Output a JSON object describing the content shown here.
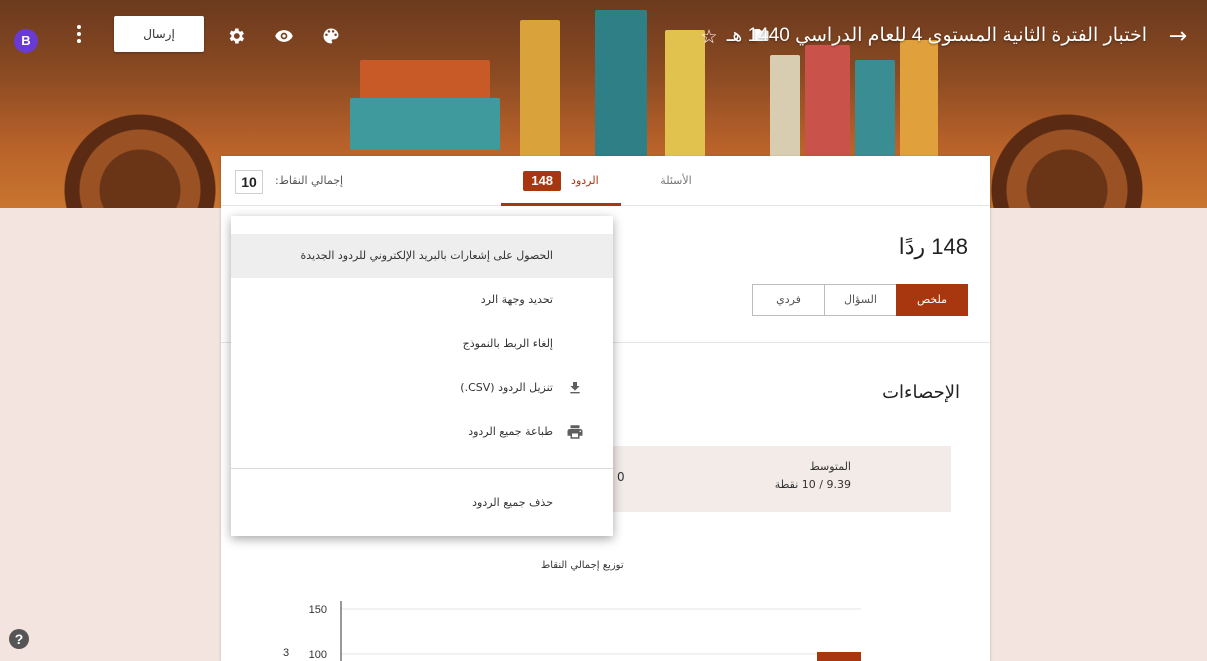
{
  "header": {
    "title": "اختبار الفترة الثانية المستوى 4 للعام الدراسي 1440 هـ",
    "avatar_letter": "B",
    "send_label": "إرسال",
    "icons": [
      "back-arrow-icon",
      "folder-icon",
      "star-icon",
      "palette-icon",
      "eye-icon",
      "gear-icon",
      "more-vert-icon"
    ]
  },
  "tabs": {
    "questions_label": "الأسئلة",
    "responses_label": "الردود",
    "responses_count": "148",
    "total_points_label": "إجمالي النقاط:",
    "total_points_value": "10"
  },
  "summary": {
    "response_count_text": "148 ردًا",
    "segments": [
      "ملخص",
      "السؤال",
      "فردي"
    ],
    "stats_title": "الإحصاءات",
    "average_label": "المتوسط",
    "average_value": "9.39 / 10 نقطة",
    "other_stat_value": "0",
    "chart_title": "توزيع إجمالي النقاط"
  },
  "menu": {
    "items": [
      {
        "label": "الحصول على إشعارات بالبريد الإلكتروني للردود الجديدة",
        "icon": ""
      },
      {
        "label": "تحديد وجهة الرد",
        "icon": ""
      },
      {
        "label": "إلغاء الربط بالنموذج",
        "icon": ""
      },
      {
        "label": "تنزيل الردود (CSV.)",
        "icon": "download-icon"
      },
      {
        "label": "طباعة جميع الردود",
        "icon": "print-icon"
      },
      {
        "label": "حذف جميع الردود",
        "icon": ""
      }
    ]
  },
  "chart_data": {
    "type": "bar",
    "title": "توزيع إجمالي النقاط",
    "yticks": [
      100,
      150
    ],
    "ylabel": "3",
    "ylim": [
      0,
      150
    ]
  },
  "colors": {
    "accent": "#a8360f",
    "background": "#f4e4df",
    "avatar": "#6a3bd1"
  }
}
